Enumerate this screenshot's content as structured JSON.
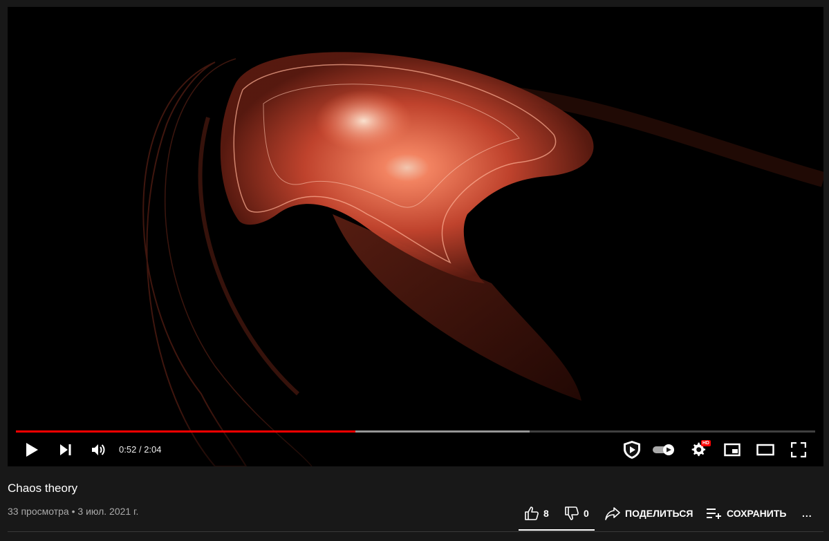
{
  "video": {
    "title": "Chaos theory",
    "views": "33 просмотра",
    "separator": "•",
    "date": "3 июл. 2021 г.",
    "progress": {
      "played_fraction": 0.425,
      "buffered_fraction": 0.643
    }
  },
  "player": {
    "time_current": "0:52",
    "time_separator": "/",
    "time_total": "2:04",
    "hd_badge": "HD",
    "colors": {
      "played": "#ff0000",
      "art_glow": "#ff6a4a"
    },
    "icons": [
      "play-icon",
      "next-icon",
      "volume-icon",
      "shield-play-icon",
      "autoplay-toggle-icon",
      "settings-icon",
      "miniplayer-icon",
      "theater-mode-icon",
      "fullscreen-icon"
    ]
  },
  "actions": {
    "likes": "8",
    "dislikes": "0",
    "share_label": "ПОДЕЛИТЬСЯ",
    "save_label": "СОХРАНИТЬ",
    "more_label": "..."
  }
}
